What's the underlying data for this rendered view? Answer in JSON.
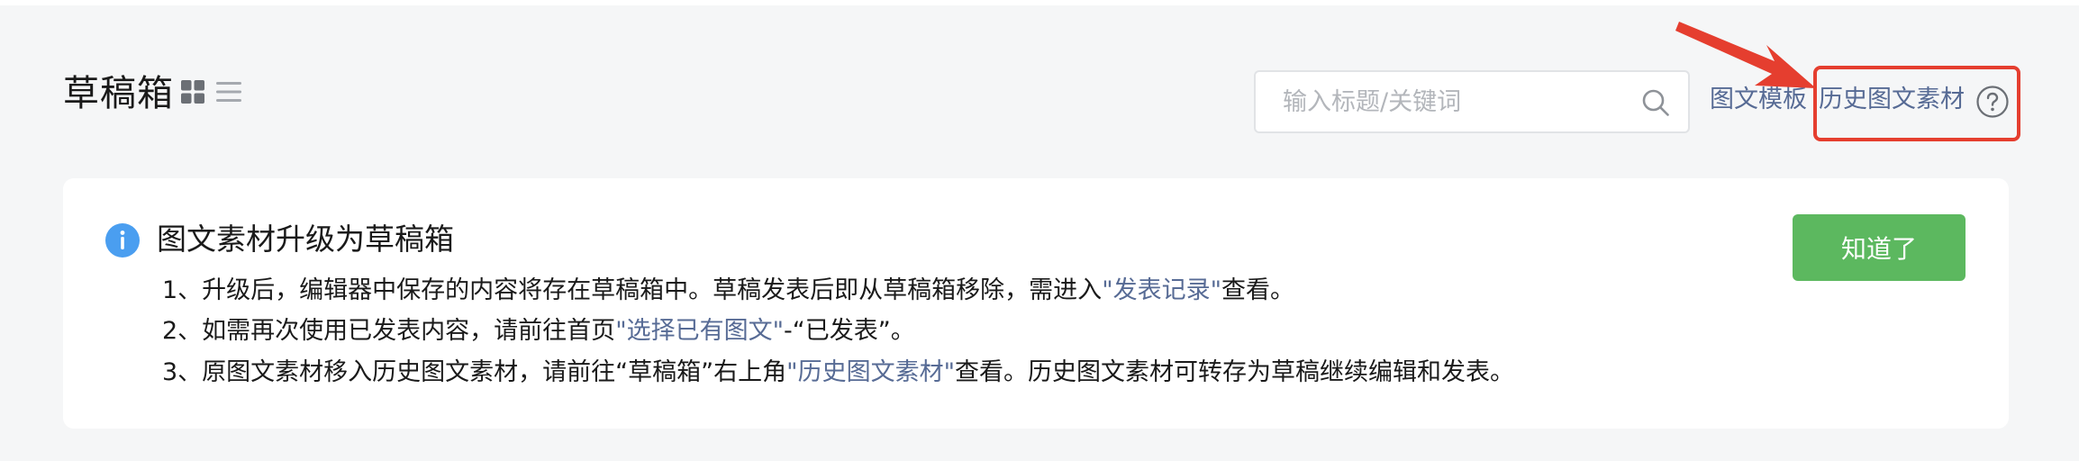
{
  "header": {
    "title": "草稿箱",
    "view_icons": [
      "grid-view-icon",
      "list-view-icon"
    ],
    "search": {
      "placeholder": "输入标题/关键词",
      "value": ""
    },
    "links": {
      "template": "图文模板",
      "history": "历史图文素材"
    },
    "help_icon": "help-circle-icon"
  },
  "notice": {
    "icon": "info-icon",
    "title": "图文素材升级为草稿箱",
    "line1": {
      "before": "1、升级后，编辑器中保存的内容将存在草稿箱中。草稿发表后即从草稿箱移除，需进入",
      "link": "\"发表记录\"",
      "after": "查看。"
    },
    "line2": {
      "before": "2、如需再次使用已发表内容，请前往首页",
      "link": "\"选择已有图文\"",
      "after": "-“已发表”。"
    },
    "line3": {
      "before": "3、原图文素材移入历史图文素材，请前往“草稿箱”右上角",
      "link": "\"历史图文素材\"",
      "after": "查看。历史图文素材可转存为草稿继续编辑和发表。"
    },
    "button_label": "知道了"
  },
  "colors": {
    "page_background": "#f5f6f7",
    "link": "#576b95",
    "button_green": "#5cb85f",
    "info_blue": "#4a9ef0",
    "annotation_red": "#e53e2f"
  }
}
